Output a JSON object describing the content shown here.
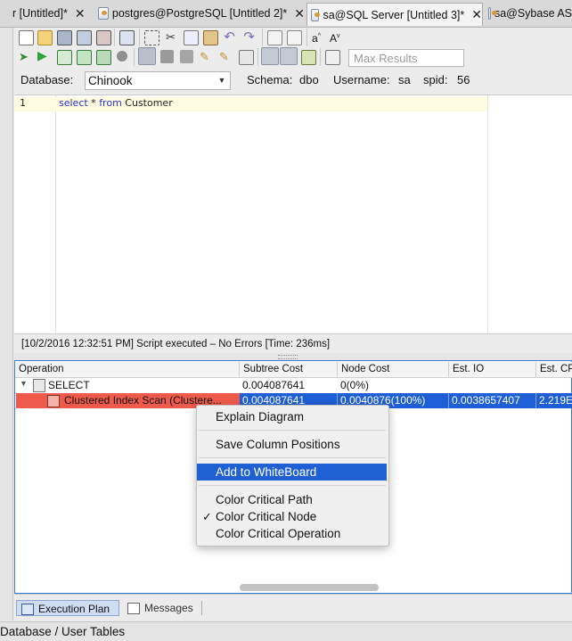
{
  "tabs": [
    {
      "label": "r [Untitled]*",
      "close": "✕"
    },
    {
      "label": "postgres@PostgreSQL [Untitled 2]*",
      "close": "✕"
    },
    {
      "label": "sa@SQL Server [Untitled 3]*",
      "close": "✕"
    },
    {
      "label": "sa@Sybase AS",
      "close": ""
    }
  ],
  "toolbar": {
    "max_results_placeholder": "Max Results",
    "font_up": "a",
    "font_up_mark": "^",
    "font_down": "A",
    "font_down_mark": "v"
  },
  "connection": {
    "database_label": "Database:",
    "database_value": "Chinook",
    "schema_label": "Schema:",
    "schema_value": "dbo",
    "username_label": "Username:",
    "username_value": "sa",
    "spid_label": "spid:",
    "spid_value": "56"
  },
  "editor": {
    "line_number": "1",
    "kw_select": "select",
    "star": " * ",
    "kw_from": "from",
    "table": " Customer"
  },
  "status": "[10/2/2016 12:32:51 PM] Script executed – No Errors [Time: 236ms]",
  "plan": {
    "columns": [
      "Operation",
      "Subtree Cost",
      "Node Cost",
      "Est. IO",
      "Est. CPU"
    ],
    "rows": [
      {
        "operation": "SELECT",
        "subtree": "0.004087641",
        "node": "0(0%)",
        "io": "",
        "cpu": ""
      },
      {
        "operation": "Clustered Index Scan (Clustere...",
        "subtree": "0.004087641",
        "node": "0.0040876(100%)",
        "io": "0.0038657407",
        "cpu": "2.219E"
      }
    ]
  },
  "context_menu": {
    "items": [
      "Explain Diagram",
      "Save Column Positions",
      "Add to WhiteBoard",
      "Color Critical Path",
      "Color Critical Node",
      "Color Critical Operation"
    ],
    "checkmark": "✓",
    "highlighted": "Add to WhiteBoard"
  },
  "bottom_tabs": [
    "Execution Plan",
    "Messages"
  ],
  "bottom_bar": "Database / User Tables",
  "colors": {
    "accent": "#1f60d4",
    "critical": "#ee5a4b"
  }
}
